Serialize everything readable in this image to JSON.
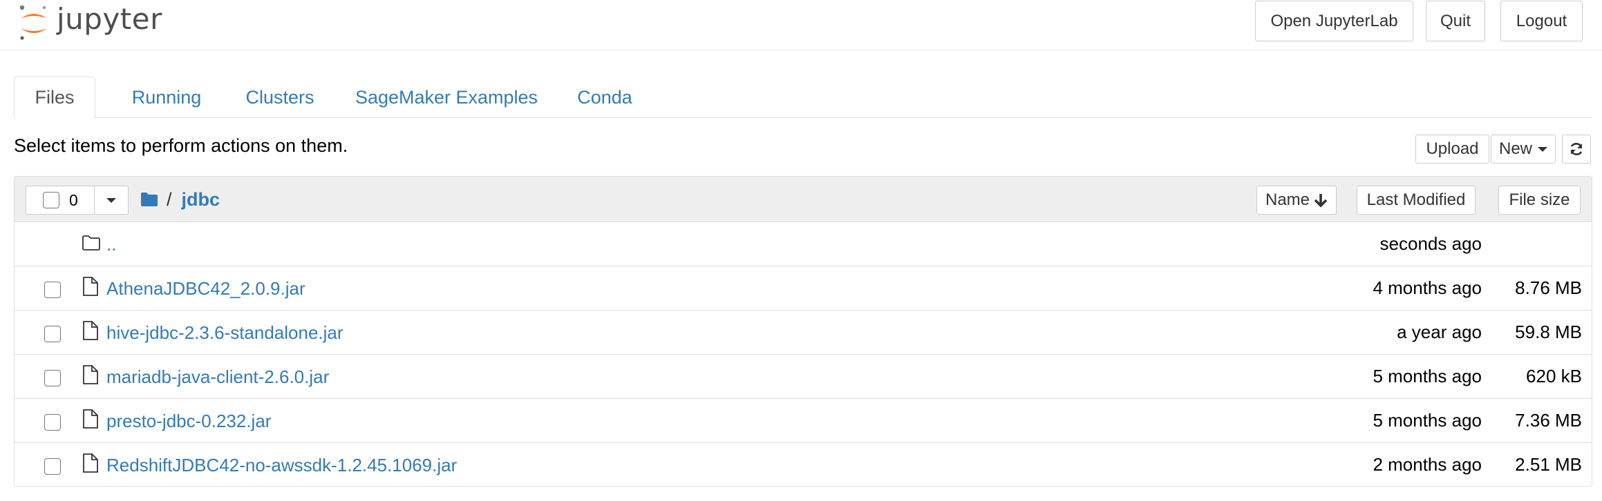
{
  "header": {
    "logo_text": "jupyter",
    "buttons": {
      "open_jupyterlab": "Open JupyterLab",
      "quit": "Quit",
      "logout": "Logout"
    }
  },
  "tabs": [
    {
      "label": "Files",
      "active": true
    },
    {
      "label": "Running",
      "active": false
    },
    {
      "label": "Clusters",
      "active": false
    },
    {
      "label": "SageMaker Examples",
      "active": false
    },
    {
      "label": "Conda",
      "active": false
    }
  ],
  "toolbar": {
    "instructions": "Select items to perform actions on them.",
    "upload_label": "Upload",
    "new_label": "New",
    "refresh_icon": "refresh-icon"
  },
  "list": {
    "selected_count": "0",
    "breadcrumb": {
      "separator": "/",
      "current": "jdbc"
    },
    "sort": {
      "name_label": "Name",
      "last_modified_label": "Last Modified",
      "file_size_label": "File size"
    },
    "parent_row": {
      "name": "..",
      "modified": "seconds ago"
    },
    "files": [
      {
        "name": "AthenaJDBC42_2.0.9.jar",
        "modified": "4 months ago",
        "size": "8.76 MB"
      },
      {
        "name": "hive-jdbc-2.3.6-standalone.jar",
        "modified": "a year ago",
        "size": "59.8 MB"
      },
      {
        "name": "mariadb-java-client-2.6.0.jar",
        "modified": "5 months ago",
        "size": "620 kB"
      },
      {
        "name": "presto-jdbc-0.232.jar",
        "modified": "5 months ago",
        "size": "7.36 MB"
      },
      {
        "name": "RedshiftJDBC42-no-awssdk-1.2.45.1069.jar",
        "modified": "2 months ago",
        "size": "2.51 MB"
      }
    ]
  },
  "colors": {
    "link": "#337ab7",
    "logo_orange": "#f37726",
    "header_bg": "#eeeeee"
  }
}
